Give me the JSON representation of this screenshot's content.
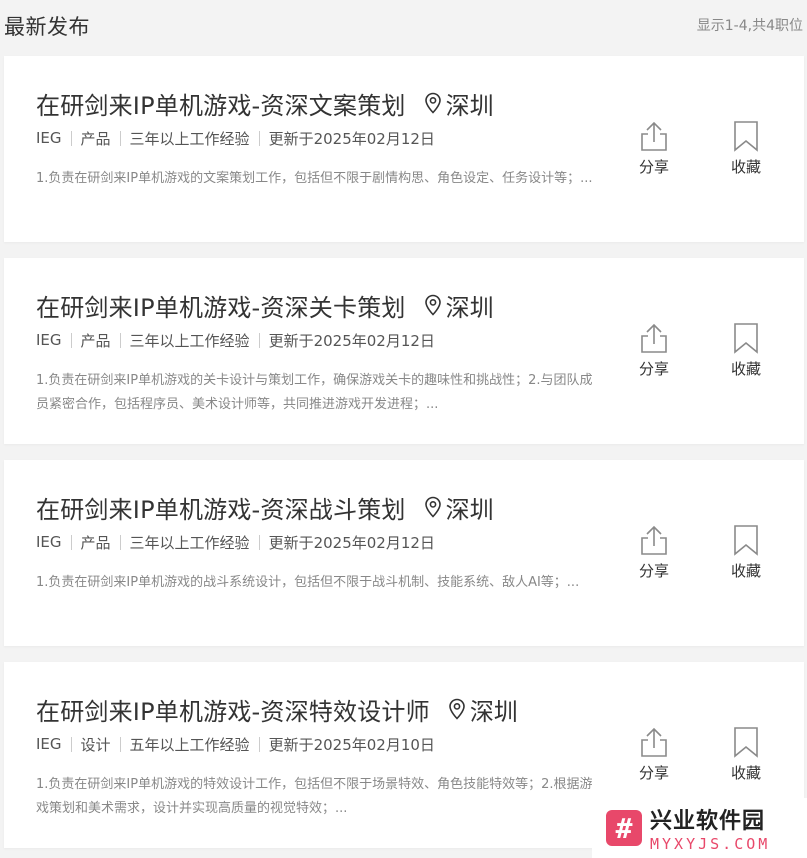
{
  "header": {
    "title": "最新发布",
    "count": "显示1-4,共4职位"
  },
  "actions": {
    "share_label": "分享",
    "save_label": "收藏"
  },
  "jobs": [
    {
      "title": "在研剑来IP单机游戏-资深文案策划",
      "location": "深圳",
      "bg": "IEG",
      "category": "产品",
      "experience": "三年以上工作经验",
      "updated": "更新于2025年02月12日",
      "desc": "1.负责在研剑来IP单机游戏的文案策划工作，包括但不限于剧情构思、角色设定、任务设计等；..."
    },
    {
      "title": "在研剑来IP单机游戏-资深关卡策划",
      "location": "深圳",
      "bg": "IEG",
      "category": "产品",
      "experience": "三年以上工作经验",
      "updated": "更新于2025年02月12日",
      "desc": "1.负责在研剑来IP单机游戏的关卡设计与策划工作，确保游戏关卡的趣味性和挑战性；2.与团队成员紧密合作，包括程序员、美术设计师等，共同推进游戏开发进程；..."
    },
    {
      "title": "在研剑来IP单机游戏-资深战斗策划",
      "location": "深圳",
      "bg": "IEG",
      "category": "产品",
      "experience": "三年以上工作经验",
      "updated": "更新于2025年02月12日",
      "desc": "1.负责在研剑来IP单机游戏的战斗系统设计，包括但不限于战斗机制、技能系统、敌人AI等；..."
    },
    {
      "title": "在研剑来IP单机游戏-资深特效设计师",
      "location": "深圳",
      "bg": "IEG",
      "category": "设计",
      "experience": "五年以上工作经验",
      "updated": "更新于2025年02月10日",
      "desc": "1.负责在研剑来IP单机游戏的特效设计工作，包括但不限于场景特效、角色技能特效等；2.根据游戏策划和美术需求，设计并实现高质量的视觉特效；..."
    }
  ],
  "watermark": {
    "icon": "#",
    "name": "兴业软件园",
    "domain": "MYXYJS.COM"
  }
}
